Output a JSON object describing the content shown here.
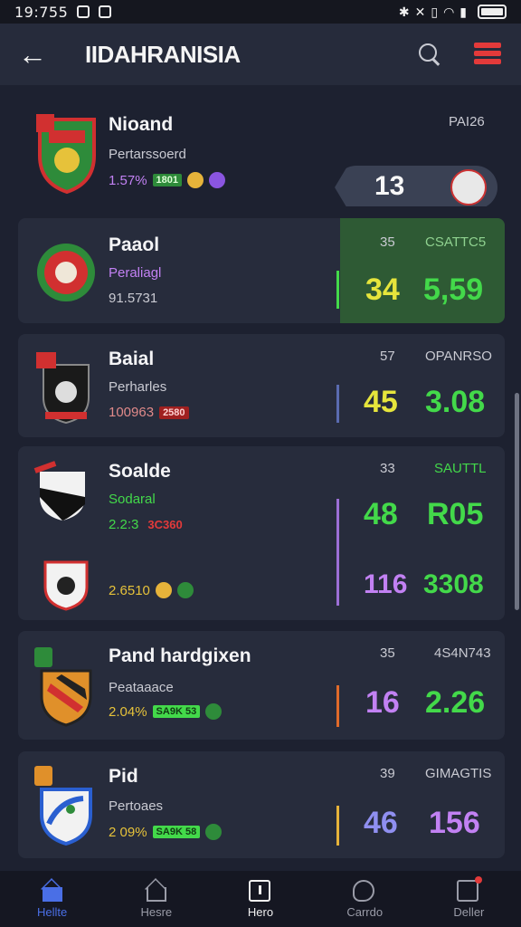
{
  "status": {
    "time": "19:755",
    "icons": [
      "bluetooth-icon",
      "mute-icon",
      "nfc-icon",
      "wifi-icon",
      "signal-icon",
      "battery-icon"
    ]
  },
  "header": {
    "title": "IIDAHRANISIA"
  },
  "colors": {
    "green": "#43d94a",
    "yellow": "#e6e53c",
    "purple": "#c281f3",
    "blue_purple": "#8f8ff0",
    "red": "#e33a3a",
    "accent": "#4a6fe6"
  },
  "cards": [
    {
      "name": "Nioand",
      "sub": "Pertarssoerd",
      "meta": "1.57%",
      "pill": "1801",
      "col1": "",
      "col2": "PAI26",
      "score": "13",
      "big1": "",
      "big2": ""
    },
    {
      "name": "Paaol",
      "sub": "Peraliagl",
      "meta": "91.5731",
      "pill": "",
      "col1": "35",
      "col2": "CSATTC5",
      "big1": "34",
      "big2": "5,59"
    },
    {
      "name": "Baial",
      "sub": "Perharles",
      "meta": "100963",
      "pill": "2580",
      "col1": "57",
      "col2": "OPANRSO",
      "big1": "45",
      "big2": "3.08"
    },
    {
      "name": "Soalde",
      "sub": "Sodaral",
      "meta": "2.2:3",
      "pill": "3C360",
      "col1": "33",
      "col2": "SAUTTL",
      "big1": "48",
      "big2": "R05",
      "meta2": "2.6510",
      "big3": "116",
      "big4": "3308"
    },
    {
      "name": "Pand hardgixen",
      "sub": "Peataaace",
      "meta": "2.04%",
      "pill": "SA9K 53",
      "col1": "35",
      "col2": "4S4N743",
      "big1": "16",
      "big2": "2.26"
    },
    {
      "name": "Pid",
      "sub": "Pertoaes",
      "meta": "2 09%",
      "pill": "SA9K 58",
      "col1": "39",
      "col2": "GIMAGTIS",
      "big1": "46",
      "big2": "156"
    }
  ],
  "nav": [
    {
      "label": "Hellte",
      "icon": "home-icon"
    },
    {
      "label": "Hesre",
      "icon": "house-outline-icon"
    },
    {
      "label": "Hero",
      "icon": "square-icon"
    },
    {
      "label": "Carrdo",
      "icon": "chat-icon"
    },
    {
      "label": "Deller",
      "icon": "edit-icon"
    }
  ]
}
